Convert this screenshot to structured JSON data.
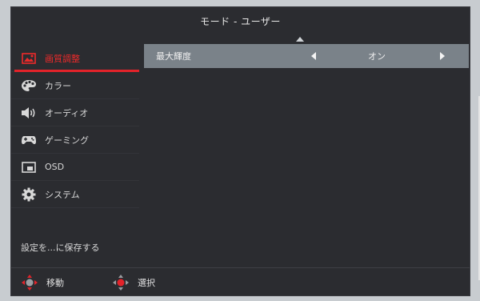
{
  "title": "モード - ユーザー",
  "sidebar": {
    "items": [
      {
        "label": "画質調整",
        "icon": "picture-icon",
        "active": true
      },
      {
        "label": "カラー",
        "icon": "palette-icon",
        "active": false
      },
      {
        "label": "オーディオ",
        "icon": "speaker-icon",
        "active": false
      },
      {
        "label": "ゲーミング",
        "icon": "gamepad-icon",
        "active": false
      },
      {
        "label": "OSD",
        "icon": "osd-icon",
        "active": false
      },
      {
        "label": "システム",
        "icon": "gear-icon",
        "active": false
      }
    ],
    "save_label": "設定を...に保存する"
  },
  "settings": {
    "max_brightness": {
      "label": "最大輝度",
      "value": "オン"
    }
  },
  "footer": {
    "move_label": "移動",
    "select_label": "選択"
  },
  "colors": {
    "accent": "#e3232a",
    "panel": "#2b2c30",
    "highlight_row": "#7a8289"
  }
}
